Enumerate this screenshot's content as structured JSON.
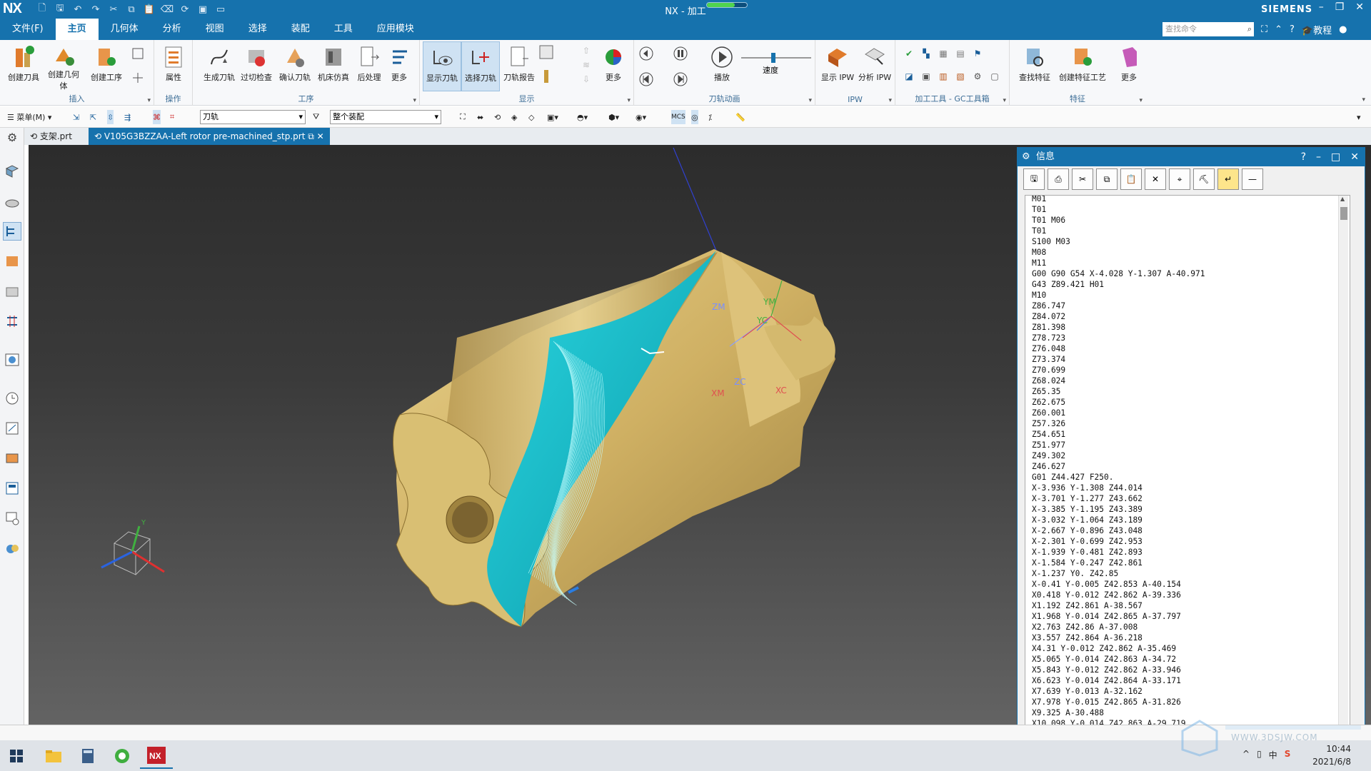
{
  "app": {
    "logo": "NX",
    "title": "NX - 加工",
    "brand": "SIEMENS",
    "progress": 0.7
  },
  "menu": {
    "tabs": [
      "文件(F)",
      "主页",
      "几何体",
      "分析",
      "视图",
      "选择",
      "装配",
      "工具",
      "应用模块"
    ],
    "active": 1,
    "search_placeholder": "查找命令",
    "tutorial": "教程"
  },
  "ribbon": {
    "groups": [
      {
        "name": "插入",
        "buttons": [
          "创建刀具",
          "创建几何体",
          "创建工序"
        ]
      },
      {
        "name": "操作",
        "buttons": [
          "属性"
        ]
      },
      {
        "name": "工序",
        "buttons": [
          "生成刀轨",
          "过切检查",
          "确认刀轨",
          "机床仿真",
          "后处理",
          "更多"
        ]
      },
      {
        "name": "显示",
        "buttons": [
          "显示刀轨",
          "选择刀轨",
          "刀轨报告",
          "更多"
        ]
      },
      {
        "name": "刀轨动画",
        "buttons": [
          "播放",
          "速度"
        ]
      },
      {
        "name": "IPW",
        "buttons": [
          "显示 IPW",
          "分析 IPW"
        ]
      },
      {
        "name": "加工工具 - GC工具箱",
        "buttons": []
      },
      {
        "name": "特征",
        "buttons": [
          "查找特征",
          "创建特征工艺",
          "更多"
        ]
      }
    ]
  },
  "toolbar2": {
    "menu_label": "菜单(M)",
    "filter_value": "刀轨",
    "scope_value": "整个装配"
  },
  "doc_tabs": [
    {
      "label": "支架.prt",
      "active": false
    },
    {
      "label": "V105G3BZZAA-Left rotor pre-machined_stp.prt",
      "active": true
    }
  ],
  "viewport": {
    "axis_labels": {
      "zm": "ZM",
      "ym": "YM",
      "yc": "YC",
      "zc": "ZC",
      "xm": "XM",
      "xc": "XC"
    },
    "triad": {
      "y": "Y"
    }
  },
  "info_window": {
    "title": "信息",
    "lines": [
      "M01",
      "T01",
      "T01 M06",
      "T01",
      "S100 M03",
      "M08",
      "M11",
      "G00 G90 G54 X-4.028 Y-1.307 A-40.971",
      "G43 Z89.421 H01",
      "M10",
      "Z86.747",
      "Z84.072",
      "Z81.398",
      "Z78.723",
      "Z76.048",
      "Z73.374",
      "Z70.699",
      "Z68.024",
      "Z65.35",
      "Z62.675",
      "Z60.001",
      "Z57.326",
      "Z54.651",
      "Z51.977",
      "Z49.302",
      "Z46.627",
      "G01 Z44.427 F250.",
      "X-3.936 Y-1.308 Z44.014",
      "X-3.701 Y-1.277 Z43.662",
      "X-3.385 Y-1.195 Z43.389",
      "X-3.032 Y-1.064 Z43.189",
      "X-2.667 Y-0.896 Z43.048",
      "X-2.301 Y-0.699 Z42.953",
      "X-1.939 Y-0.481 Z42.893",
      "X-1.584 Y-0.247 Z42.861",
      "X-1.237 Y0. Z42.85",
      "X-0.41 Y-0.005 Z42.853 A-40.154",
      "X0.418 Y-0.012 Z42.862 A-39.336",
      "X1.192 Z42.861 A-38.567",
      "X1.968 Y-0.014 Z42.865 A-37.797",
      "X2.763 Z42.86 A-37.008",
      "X3.557 Z42.864 A-36.218",
      "X4.31 Y-0.012 Z42.862 A-35.469",
      "X5.065 Y-0.014 Z42.863 A-34.72",
      "X5.843 Y-0.012 Z42.862 A-33.946",
      "X6.623 Y-0.014 Z42.864 A-33.171",
      "X7.639 Y-0.013 A-32.162",
      "X7.978 Y-0.015 Z42.865 A-31.826",
      "X9.325 A-30.488",
      "X10.098 Y-0.014 Z42.863 A-29.719"
    ]
  },
  "taskbar": {
    "time": "10:44",
    "date": "2021/6/8",
    "ime": "中",
    "watermark": "WWW.3DSJW.COM"
  }
}
